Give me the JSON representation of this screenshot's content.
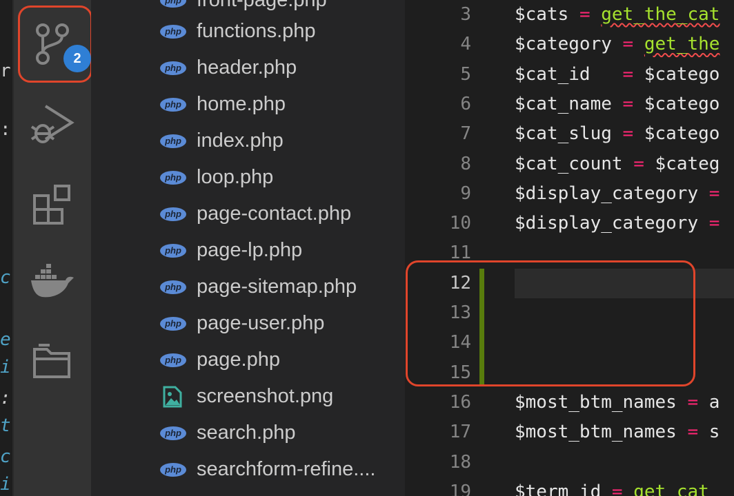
{
  "activity_bar": {
    "source_control_badge": "2",
    "icons": [
      "source-control-icon",
      "run-debug-icon",
      "extensions-icon",
      "docker-icon",
      "folder-icon"
    ]
  },
  "left_strip": [
    "r",
    ":",
    "c",
    "e",
    "i",
    ":",
    "t",
    "c",
    "i"
  ],
  "explorer": {
    "partial_top": "front-page.php",
    "files": [
      {
        "name": "functions.php",
        "icon": "php"
      },
      {
        "name": "header.php",
        "icon": "php"
      },
      {
        "name": "home.php",
        "icon": "php"
      },
      {
        "name": "index.php",
        "icon": "php"
      },
      {
        "name": "loop.php",
        "icon": "php"
      },
      {
        "name": "page-contact.php",
        "icon": "php"
      },
      {
        "name": "page-lp.php",
        "icon": "php"
      },
      {
        "name": "page-sitemap.php",
        "icon": "php"
      },
      {
        "name": "page-user.php",
        "icon": "php"
      },
      {
        "name": "page.php",
        "icon": "php"
      },
      {
        "name": "screenshot.png",
        "icon": "image"
      },
      {
        "name": "search.php",
        "icon": "php"
      },
      {
        "name": "searchform-refine....",
        "icon": "php"
      }
    ],
    "php_icon_label": "php"
  },
  "editor": {
    "lines": [
      {
        "num": "3",
        "var": "$cats",
        "pad": " ",
        "op": "=",
        "fn": "get_the_cat",
        "squiggle": true
      },
      {
        "num": "4",
        "var": "$category",
        "pad": " ",
        "op": "=",
        "fn": "get_the",
        "squiggle": true
      },
      {
        "num": "5",
        "var": "$cat_id",
        "pad": "   ",
        "op": "=",
        "rest": "$catego"
      },
      {
        "num": "6",
        "var": "$cat_name",
        "pad": " ",
        "op": "=",
        "rest": "$catego"
      },
      {
        "num": "7",
        "var": "$cat_slug",
        "pad": " ",
        "op": "=",
        "rest": "$catego"
      },
      {
        "num": "8",
        "var": "$cat_count",
        "pad": " ",
        "op": "=",
        "rest": "$categ"
      },
      {
        "num": "9",
        "var": "$display_category",
        "pad": " ",
        "op": "="
      },
      {
        "num": "10",
        "var": "$display_category",
        "pad": " ",
        "op": "="
      },
      {
        "num": "11"
      },
      {
        "num": "12",
        "active": true
      },
      {
        "num": "13"
      },
      {
        "num": "14"
      },
      {
        "num": "15"
      },
      {
        "num": "16",
        "var": "$most_btm_names",
        "pad": " ",
        "op": "=",
        "rest": "a"
      },
      {
        "num": "17",
        "var": "$most_btm_names",
        "pad": " ",
        "op": "=",
        "rest": "s"
      },
      {
        "num": "18"
      },
      {
        "num": "19",
        "var": "$term_id",
        "pad": " ",
        "op": "=",
        "fn": "get_cat"
      }
    ]
  },
  "colors": {
    "highlight_border": "#e0452b",
    "badge": "#2f7fd5",
    "added_gutter": "#587c0c",
    "operator": "#f92672",
    "function": "#a6e22e"
  }
}
